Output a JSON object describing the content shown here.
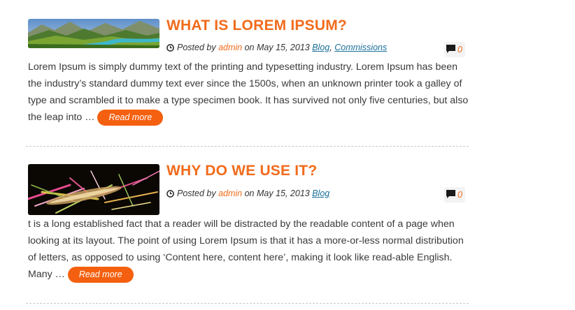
{
  "posts": [
    {
      "title": "WHAT IS LOREM IPSUM?",
      "posted_by_prefix": "Posted by",
      "author": "admin",
      "date_text": "on May 15, 2013",
      "categories": [
        "Blog",
        "Commissions"
      ],
      "category_separator": ",",
      "comments": "0",
      "excerpt": "Lorem Ipsum is simply dummy text of the printing and typesetting industry. Lorem Ipsum has been the industry’s standard dummy text ever since the 1500s, when an unknown printer took a galley of type and scrambled it to make a type specimen book. It has survived not only five centuries, but also the leap into …",
      "read_more": "Read more",
      "thumbnail_icon": "mountain-valley-image"
    },
    {
      "title": "WHY DO WE USE IT?",
      "posted_by_prefix": "Posted by",
      "author": "admin",
      "date_text": "on May 15, 2013",
      "categories": [
        "Blog"
      ],
      "comments": "0",
      "excerpt": "t is a long established fact that a reader will be distracted by the readable content of a page when looking at its layout. The point of using Lorem Ipsum is that it has a more-or-less normal distribution of letters, as opposed to using ‘Content here, content here’, making it look like read-able English. Many …",
      "read_more": "Read more",
      "thumbnail_icon": "abstract-splash-image"
    }
  ],
  "colors": {
    "accent": "#f16b1c",
    "button": "#f4600f",
    "link": "#1a6f9a",
    "text": "#3a3a3a"
  },
  "icons": {
    "meta": "clock-icon",
    "comments": "comment-icon"
  }
}
